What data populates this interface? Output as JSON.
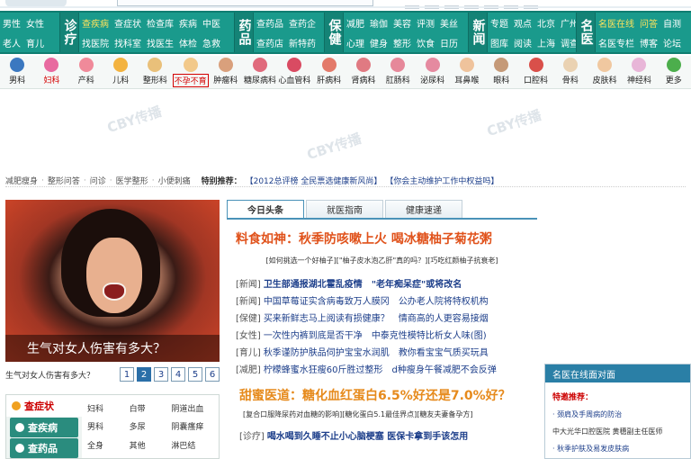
{
  "nav": {
    "groups": [
      {
        "cols": [
          [
            "男性",
            "老人"
          ],
          [
            "女性",
            "育儿"
          ]
        ]
      },
      {
        "big": "诊疗",
        "cols": [
          [
            "查疾病",
            "找医院"
          ],
          [
            "查症状",
            "找科室"
          ],
          [
            "检查库",
            "找医生"
          ],
          [
            "疾病",
            "体检"
          ],
          [
            "中医",
            "急救"
          ]
        ]
      },
      {
        "big": "药品",
        "cols": [
          [
            "查药品",
            "查药店"
          ],
          [
            "查药企",
            "新特药"
          ]
        ]
      },
      {
        "big": "保健",
        "cols": [
          [
            "减肥",
            "心理"
          ],
          [
            "瑜伽",
            "健身"
          ],
          [
            "美容",
            "整形"
          ],
          [
            "评测",
            "饮食"
          ],
          [
            "美丝",
            "日历"
          ]
        ]
      },
      {
        "big": "新闻",
        "cols": [
          [
            "专题",
            "图库"
          ],
          [
            "观点",
            "阅读"
          ],
          [
            "北京",
            "上海"
          ],
          [
            "广州",
            "调查"
          ]
        ]
      },
      {
        "big": "名医",
        "cols": [
          [
            "名医在线",
            "名医专栏"
          ],
          [
            "问答",
            "博客"
          ],
          [
            "自测",
            "论坛"
          ]
        ]
      }
    ]
  },
  "icons": [
    {
      "label": "男科",
      "color": "#3b78c0"
    },
    {
      "label": "妇科",
      "color": "#e86aa0",
      "red": true
    },
    {
      "label": "产科",
      "color": "#f08a9a"
    },
    {
      "label": "儿科",
      "color": "#f3b340"
    },
    {
      "label": "整形科",
      "color": "#e9c07a"
    },
    {
      "label": "不孕不育",
      "color": "#f2c98a",
      "sel": true
    },
    {
      "label": "肿瘤科",
      "color": "#d9a07c"
    },
    {
      "label": "糖尿病科",
      "color": "#e06a7c"
    },
    {
      "label": "心血管科",
      "color": "#d94b62"
    },
    {
      "label": "肝病科",
      "color": "#e37a6a"
    },
    {
      "label": "肾病科",
      "color": "#e07a82"
    },
    {
      "label": "肛肠科",
      "color": "#e6889a"
    },
    {
      "label": "泌尿科",
      "color": "#e58aa0"
    },
    {
      "label": "耳鼻喉",
      "color": "#efc39c"
    },
    {
      "label": "眼科",
      "color": "#c59a78"
    },
    {
      "label": "口腔科",
      "color": "#d9504a"
    },
    {
      "label": "骨科",
      "color": "#ead2b2"
    },
    {
      "label": "皮肤科",
      "color": "#f0c8a0"
    },
    {
      "label": "神经科",
      "color": "#e8b6d8"
    },
    {
      "label": "更多",
      "color": "#4cae4c"
    }
  ],
  "watermarks": [
    "CBY传播",
    "CBY传播",
    "CBY传播",
    "CBY传播",
    "CBY传播"
  ],
  "breadcrumb": {
    "items": [
      "减肥瘦身",
      "整形问答",
      "问诊",
      "医学整形",
      "小便刺痛"
    ],
    "special_label": "特别推荐：",
    "rec1": "【2012总评榜 全民票选健康新风尚】",
    "rec2": "【你会主动维护工作中权益吗】"
  },
  "hero": {
    "caption": "生气对女人伤害有多大？"
  },
  "pager": {
    "text": "生气对女人伤害有多大？",
    "pages": [
      "1",
      "2",
      "3",
      "4",
      "5",
      "6"
    ],
    "current": "2"
  },
  "symptom": {
    "tabs": [
      "查症状",
      "查疾病",
      "查药品"
    ],
    "grid": [
      "妇科",
      "白带",
      "阴道出血",
      "男科",
      "多尿",
      "阴囊瘙痒",
      "全身",
      "其他",
      "淋巴结"
    ]
  },
  "center": {
    "tabs": [
      "今日头条",
      "就医指南",
      "健康速递"
    ],
    "headline": "料食如神：秋季防咳嗽上火 喝冰糖柚子菊花粥",
    "subline": "[如何挑选一个好柚子][\"柚子皮水泡乙肝\"真的吗？][巧吃红颜柚子抗衰老]",
    "news": [
      {
        "cat": "[新闻]",
        "a": "卫生部通报湖北霍乱疫情",
        "b": "\"老年痴呆症\"或将改名"
      },
      {
        "cat": "[新闻]",
        "a": "中国草莓证实含病毒致万人膜冈",
        "b": "公办老人院将特权机构"
      },
      {
        "cat": "[保健]",
        "a": "买来新鲜志马上阅读有损健康？",
        "b": "情商高的人更容易接烟"
      },
      {
        "cat": "[女性]",
        "a": "一次性内裤到底是否干净",
        "b": "中泰克性模特比析女人味(图)"
      },
      {
        "cat": "[育儿]",
        "a": "秋季谨防护肤品伺护宝宝水润肌",
        "b": "教你看宝宝气质买玩具"
      },
      {
        "cat": "[减肥]",
        "a": "柠檬蜂蜜水狂瘦60斤胜过整形",
        "b": "d种瘦身午餐减肥不会反弹"
      }
    ],
    "headline2": "甜蜜医道：糖化血红蛋白6.5%好还是7.0%好？",
    "subline2": "[复合口服降尿药对血糖的影响][糖化蛋白5.1最佳界点][糖友夫妻备孕方]",
    "lastcat": "[诊疗]",
    "last": "喝水喝到久睡不止小心脑梗塞  医保卡拿到手该怎用"
  },
  "rightbox": {
    "title": "名医在线面对面",
    "section": "特邀推荐：",
    "items": [
      "· 颈肩及手周病的防治",
      "中大光华口腔医院 黄穗副主任医师",
      "· 秋季护肤及易发皮肤病"
    ]
  }
}
